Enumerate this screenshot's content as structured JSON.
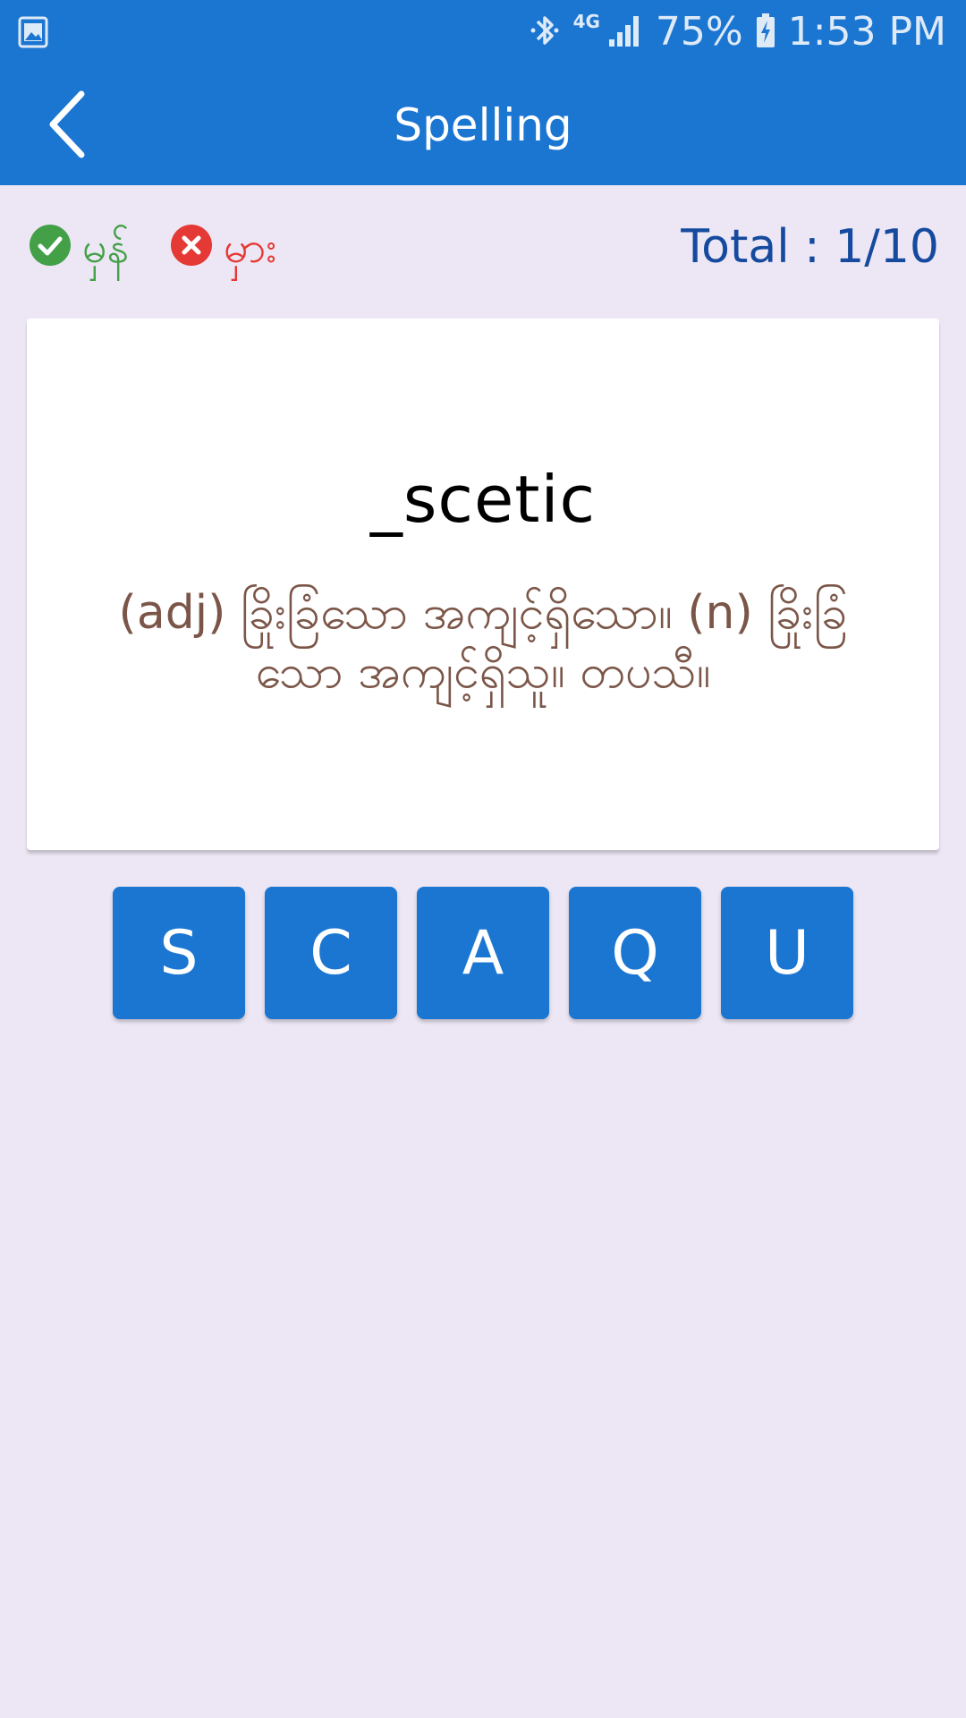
{
  "status_bar": {
    "network": "4G",
    "battery": "75%",
    "time": "1:53 PM",
    "icons": [
      "gallery-icon",
      "bluetooth-icon",
      "signal-icon",
      "battery-charging-icon"
    ]
  },
  "app_bar": {
    "title": "Spelling",
    "back_icon": "chevron-left-icon"
  },
  "score": {
    "correct_label": "မှန်",
    "wrong_label": "မှား",
    "total": "Total : 1/10"
  },
  "card": {
    "word": "_scetic",
    "meaning": "(adj) ခြိုးခြံသော အကျင့်ရှိသော။ (n) ခြိုးခြံသော အကျင့်ရှိသူ။ တပသီ။"
  },
  "letters": [
    "S",
    "C",
    "A",
    "Q",
    "U"
  ],
  "colors": {
    "primary": "#1b76d2",
    "background": "#ede7f5",
    "correct": "#43a047",
    "wrong": "#e53935",
    "meaning_text": "#7b5648",
    "total_text": "#154a9e"
  }
}
